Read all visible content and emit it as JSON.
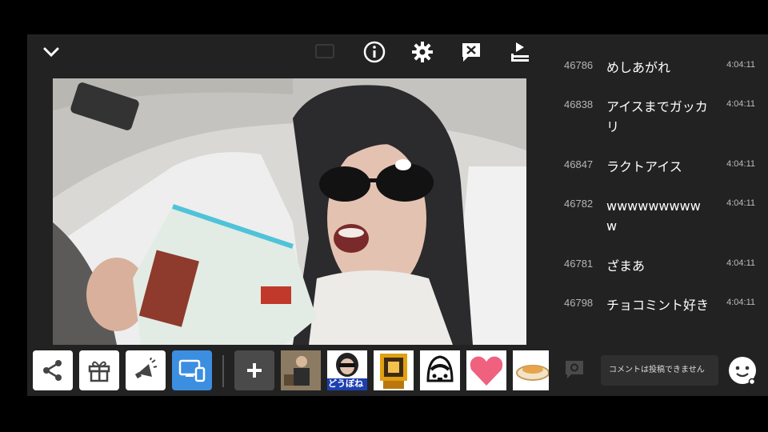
{
  "header": {
    "icons": [
      "chevron-down-icon",
      "cast-icon",
      "info-icon",
      "gear-icon",
      "comment-off-icon",
      "playlist-icon"
    ]
  },
  "toolbar": {
    "buttons": [
      "share-icon",
      "gift-icon",
      "megaphone-icon",
      "screen-devices-icon",
      "add-icon"
    ],
    "stamps": [
      {
        "name": "stamp-photo-man",
        "label": ""
      },
      {
        "name": "stamp-dou-bo-ne",
        "label": "どうぼね"
      },
      {
        "name": "stamp-gold-shrine",
        "label": ""
      },
      {
        "name": "stamp-train",
        "label": ""
      },
      {
        "name": "stamp-heart",
        "label": ""
      },
      {
        "name": "stamp-bowl",
        "label": ""
      }
    ],
    "accent": "#3b8ee0"
  },
  "comments": [
    {
      "num": "46786",
      "text": "めしあがれ",
      "time": "4:04:11"
    },
    {
      "num": "46838",
      "text": "アイスまでガッカリ",
      "time": "4:04:11"
    },
    {
      "num": "46847",
      "text": "ラクトアイス",
      "time": "4:04:11"
    },
    {
      "num": "46782",
      "text": "wwwwwwwwww",
      "time": "4:04:11"
    },
    {
      "num": "46781",
      "text": "ざまあ",
      "time": "4:04:11"
    },
    {
      "num": "46798",
      "text": "チョコミント好き",
      "time": "4:04:11"
    }
  ],
  "comment_bar": {
    "placeholder": "コメントは投稿できません"
  }
}
